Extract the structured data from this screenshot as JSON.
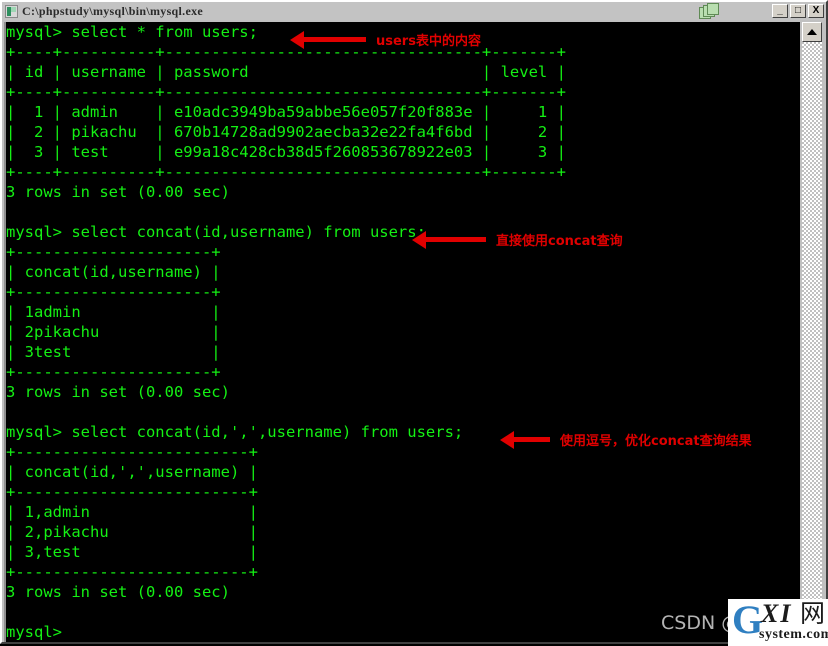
{
  "window": {
    "title": "C:\\phpstudy\\mysql\\bin\\mysql.exe",
    "icon": "console-icon",
    "buttons": {
      "minimize": "_",
      "maximize": "□",
      "close": "X"
    },
    "cascade_icon": "cascade-windows-icon"
  },
  "colors": {
    "console_bg": "#000000",
    "console_fg": "#14f014",
    "annotation": "#e00000",
    "titlebar_bg": "#c3c3c3",
    "chrome": "#c0c0c0",
    "watermark": "#b4b4b4",
    "logo_blue": "#2f7fc1"
  },
  "terminal": {
    "lines": [
      "mysql> select * from users;",
      "+----+----------+----------------------------------+-------+",
      "| id | username | password                         | level |",
      "+----+----------+----------------------------------+-------+",
      "|  1 | admin    | e10adc3949ba59abbe56e057f20f883e |     1 |",
      "|  2 | pikachu  | 670b14728ad9902aecba32e22fa4f6bd |     2 |",
      "|  3 | test     | e99a18c428cb38d5f260853678922e03 |     3 |",
      "+----+----------+----------------------------------+-------+",
      "3 rows in set (0.00 sec)",
      "",
      "mysql> select concat(id,username) from users;",
      "+---------------------+",
      "| concat(id,username) |",
      "+---------------------+",
      "| 1admin              |",
      "| 2pikachu            |",
      "| 3test               |",
      "+---------------------+",
      "3 rows in set (0.00 sec)",
      "",
      "mysql> select concat(id,',',username) from users;",
      "+-------------------------+",
      "| concat(id,',',username) |",
      "+-------------------------+",
      "| 1,admin                 |",
      "| 2,pikachu               |",
      "| 3,test                  |",
      "+-------------------------+",
      "3 rows in set (0.00 sec)",
      "",
      "mysql>"
    ],
    "prompt": "mysql>"
  },
  "annotations": [
    {
      "text": "users表中的内容",
      "arrow": "left-arrow"
    },
    {
      "text": "直接使用concat查询",
      "arrow": "left-arrow"
    },
    {
      "text": "使用逗号，优化concat查询结果",
      "arrow": "left-arrow"
    }
  ],
  "watermark": {
    "text": "CSDN @",
    "logo": {
      "g": "G",
      "xi": "XI",
      "net": "网",
      "sub": "system.com"
    }
  },
  "scrollbar": {
    "up_arrow": "scroll-up-arrow"
  }
}
